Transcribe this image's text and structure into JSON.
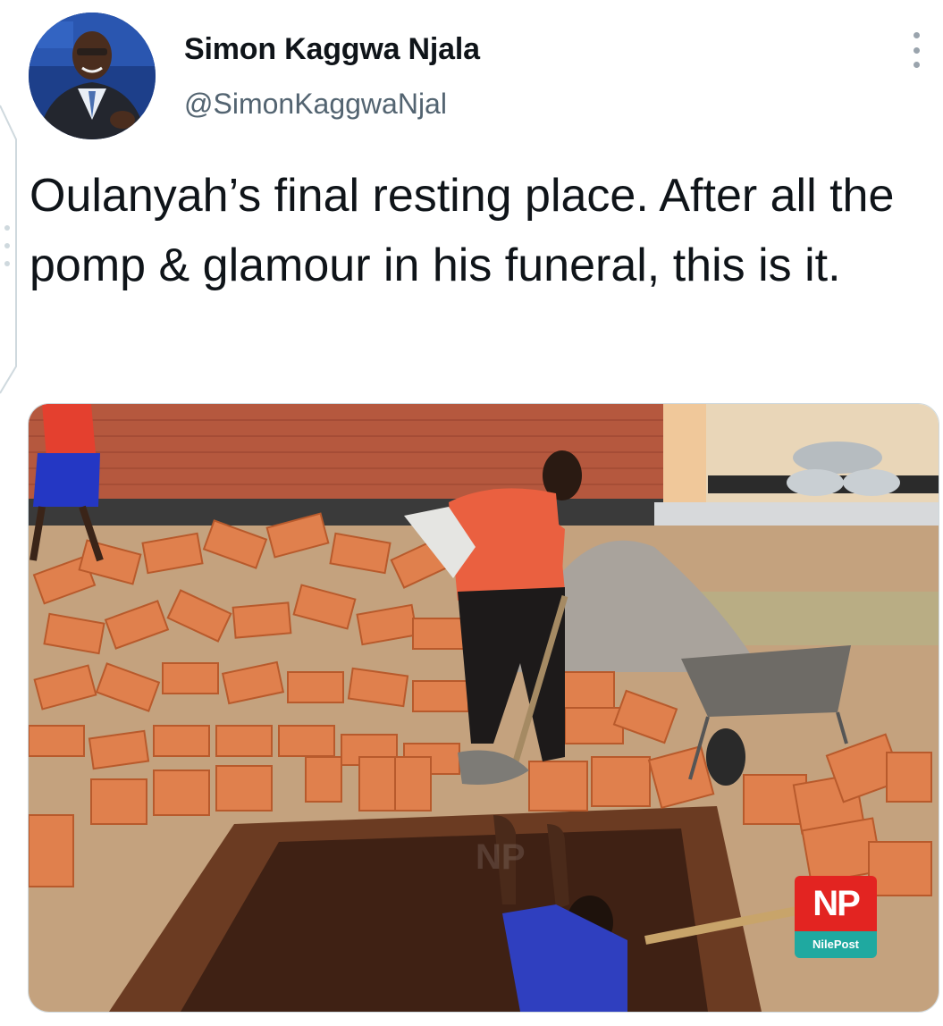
{
  "author": {
    "name": "Simon Kaggwa Njala",
    "handle": "@SimonKaggwaNjal"
  },
  "tweet": {
    "text": "Oulanyah’s final resting place. After all the pomp & glamour in his funeral, this is it."
  },
  "media": {
    "watermark_logo": "NP",
    "watermark_label": "NilePost"
  },
  "icons": {
    "menu": "more-options-icon"
  },
  "colors": {
    "name_text": "#0f1419",
    "handle_text": "#536471",
    "logo_red": "#e32421",
    "logo_teal": "#1fa9a0"
  }
}
